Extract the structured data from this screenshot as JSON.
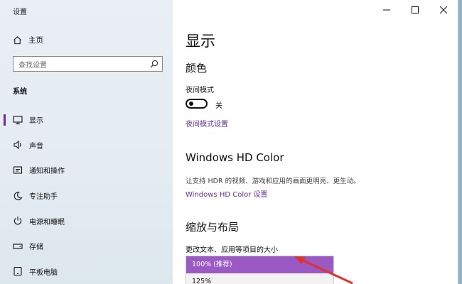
{
  "window": {
    "title": "设置"
  },
  "sidebar": {
    "home_label": "主页",
    "search_placeholder": "查找设置",
    "section_label": "系统",
    "items": [
      {
        "label": "显示",
        "icon": "monitor-icon",
        "active": true
      },
      {
        "label": "声音",
        "icon": "speaker-icon",
        "active": false
      },
      {
        "label": "通知和操作",
        "icon": "notification-icon",
        "active": false
      },
      {
        "label": "专注助手",
        "icon": "moon-icon",
        "active": false
      },
      {
        "label": "电源和睡眠",
        "icon": "power-icon",
        "active": false
      },
      {
        "label": "存储",
        "icon": "storage-icon",
        "active": false
      },
      {
        "label": "平板电脑",
        "icon": "tablet-icon",
        "active": false
      }
    ]
  },
  "main": {
    "page_title": "显示",
    "color_section": {
      "heading": "颜色",
      "night_mode_label": "夜间模式",
      "toggle_state": "关",
      "night_settings_link": "夜间模式设置"
    },
    "hd_section": {
      "heading": "Windows HD Color",
      "description": "让支持 HDR 的视频、游戏和应用的画面更明亮、更生动。",
      "link": "Windows HD Color 设置"
    },
    "scale_section": {
      "heading": "缩放与布局",
      "label": "更改文本、应用等项目的大小",
      "options": [
        "100% (推荐)",
        "125%"
      ],
      "selected_index": 0
    }
  },
  "colors": {
    "accent": "#6b2fa3",
    "selected_option": "#9b59c4",
    "annotation_arrow": "#e0332c"
  }
}
